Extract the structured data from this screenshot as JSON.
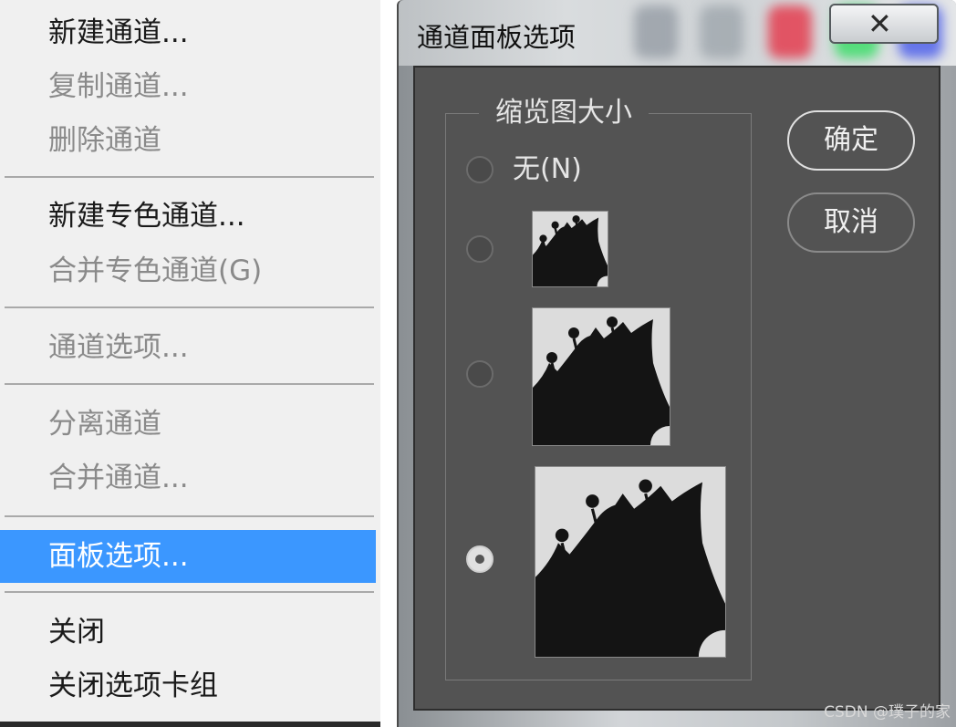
{
  "menu": {
    "items": [
      {
        "label": "新建通道...",
        "enabled": true
      },
      {
        "label": "复制通道...",
        "enabled": false
      },
      {
        "label": "删除通道",
        "enabled": false
      },
      {
        "label": "新建专色通道...",
        "enabled": true
      },
      {
        "label": "合并专色通道(G)",
        "enabled": false
      },
      {
        "label": "通道选项...",
        "enabled": false
      },
      {
        "label": "分离通道",
        "enabled": false
      },
      {
        "label": "合并通道...",
        "enabled": false
      },
      {
        "label": "面板选项...",
        "enabled": true,
        "highlighted": true
      },
      {
        "label": "关闭",
        "enabled": true
      },
      {
        "label": "关闭选项卡组",
        "enabled": true
      }
    ],
    "highlight_color": "#3b97ff"
  },
  "dialog": {
    "title": "通道面板选项",
    "close_icon": "close-icon",
    "group_title": "缩览图大小",
    "options": [
      {
        "label": "无(N)",
        "size": "none",
        "selected": false
      },
      {
        "label": "",
        "size": "small",
        "selected": false
      },
      {
        "label": "",
        "size": "medium",
        "selected": false
      },
      {
        "label": "",
        "size": "large",
        "selected": true
      }
    ],
    "ok_label": "确定",
    "cancel_label": "取消",
    "background_color": "#535353"
  },
  "watermark": "CSDN @璞子的家"
}
